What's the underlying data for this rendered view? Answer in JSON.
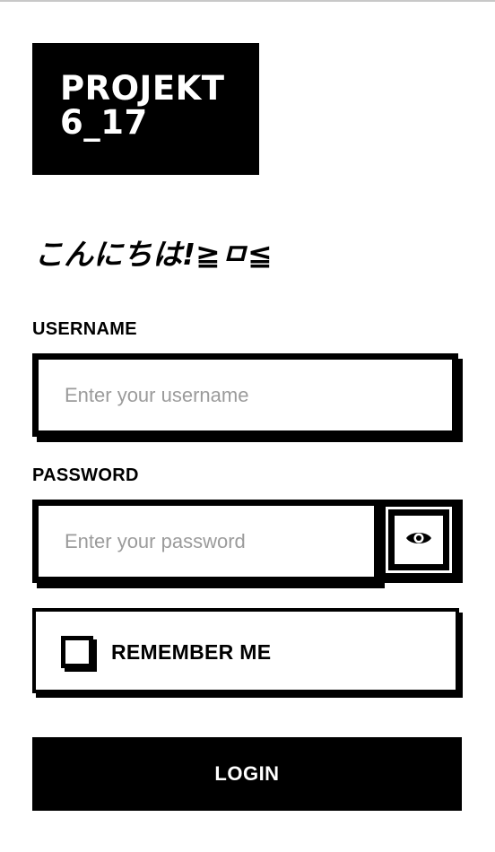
{
  "app": {
    "logo_line1": "PROJEKT",
    "logo_line2": "6_17"
  },
  "greeting": "こんにちは!≧ㅁ≦",
  "form": {
    "username": {
      "label": "USERNAME",
      "placeholder": "Enter your username",
      "value": ""
    },
    "password": {
      "label": "PASSWORD",
      "placeholder": "Enter your password",
      "value": "",
      "toggle_icon": "eye-icon"
    },
    "remember": {
      "label": "REMEMBER ME",
      "checked": false
    },
    "login_label": "LOGIN"
  },
  "colors": {
    "primary": "#000000",
    "background": "#ffffff",
    "placeholder": "#9b9b9b"
  }
}
